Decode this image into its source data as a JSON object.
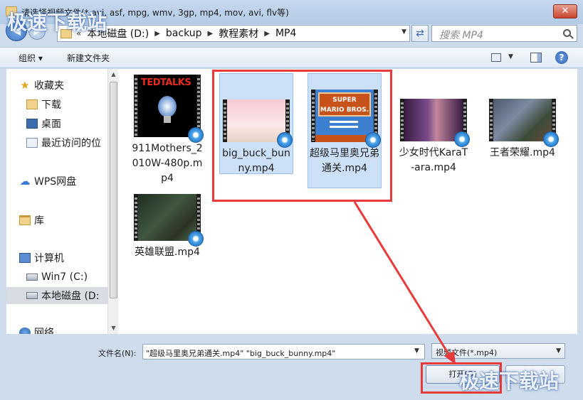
{
  "window": {
    "title": "请选择视频文件(*.avi, asf, mpg, wmv, 3gp, mp4, mov, avi, flv等)",
    "close_label": "✕"
  },
  "watermark": "极速下载站",
  "address": {
    "prefix": "«",
    "crumbs": [
      "本地磁盘 (D:)",
      "backup",
      "教程素材",
      "MP4"
    ],
    "search_placeholder": "搜索 MP4"
  },
  "toolbar": {
    "organize": "组织 ▾",
    "new_folder": "新建文件夹"
  },
  "nav": {
    "items": [
      {
        "label": "收藏夹",
        "icon": "star-icon"
      },
      {
        "label": "下载",
        "icon": "folder-icon"
      },
      {
        "label": "桌面",
        "icon": "desktop-icon"
      },
      {
        "label": "最近访问的位",
        "icon": "recent-icon"
      },
      {
        "label": "WPS网盘",
        "icon": "cloud-icon"
      },
      {
        "label": "库",
        "icon": "library-icon"
      },
      {
        "label": "计算机",
        "icon": "computer-icon"
      },
      {
        "label": "Win7 (C:)",
        "icon": "drive-icon"
      },
      {
        "label": "本地磁盘 (D:",
        "icon": "drive-icon",
        "selected": true
      },
      {
        "label": "网络",
        "icon": "network-icon"
      }
    ]
  },
  "files": [
    {
      "name": "911Mothers_2010W-480p.mp4",
      "thumb_text": "TEDTALKS",
      "selected": false
    },
    {
      "name": "big_buck_bunny.mp4",
      "selected": true
    },
    {
      "name": "超级马里奥兄弟通关.mp4",
      "thumb_text": "SUPER MARIO BROS.",
      "selected": true
    },
    {
      "name": "少女时代KaraT-ara.mp4",
      "selected": false
    },
    {
      "name": "王者荣耀.mp4",
      "selected": false
    },
    {
      "name": "英雄联盟.mp4",
      "selected": false
    }
  ],
  "bottom": {
    "filename_label": "文件名(N):",
    "filename_value": "\"超级马里奥兄弟通关.mp4\" \"big_buck_bunny.mp4\"",
    "type_value": "视频文件(*.mp4)",
    "open_label": "打开(O)",
    "cancel_label": "取消"
  },
  "colors": {
    "highlight": "#e83a3a",
    "selection": "#cce1f7"
  }
}
